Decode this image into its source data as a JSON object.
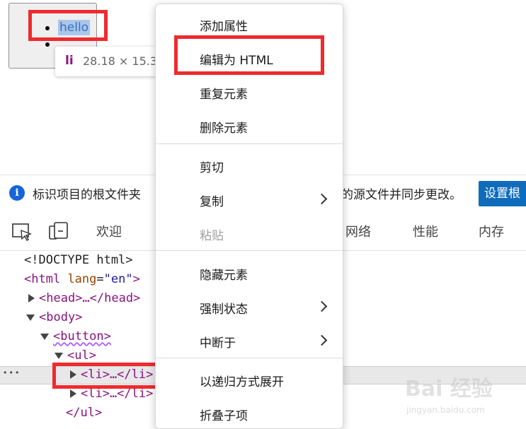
{
  "preview": {
    "list_item_text": "hello",
    "tooltip_tag": "li",
    "tooltip_size": "28.18 × 15.3"
  },
  "infobar": {
    "text_left": "标识项目的根文件夹",
    "text_right": "的源文件并同步更改。",
    "button_label": "设置根"
  },
  "tabs": {
    "welcome": "欢迎",
    "network": "网络",
    "performance": "性能",
    "memory": "内存"
  },
  "dom": {
    "doctype": "<!DOCTYPE html>",
    "html_tag_open": "<html",
    "html_attr": "lang",
    "html_eq": "=",
    "html_attr_value": "\"en\"",
    "html_tag_close": ">",
    "head": "<head>…</head>",
    "body": "<body>",
    "button": "<button>",
    "ul": "<ul>",
    "li_selected": "<li>…</li>",
    "li_second": "<li>…</li>",
    "ul_close": "</ul>",
    "row_dots": "•••"
  },
  "context_menu": {
    "items": [
      {
        "label": "添加属性"
      },
      {
        "label": "编辑为 HTML"
      },
      {
        "label": "重复元素"
      },
      {
        "label": "删除元素"
      },
      {
        "label": "剪切"
      },
      {
        "label": "复制"
      },
      {
        "label": "粘贴"
      },
      {
        "label": "隐藏元素"
      },
      {
        "label": "强制状态"
      },
      {
        "label": "中断于"
      },
      {
        "label": "以递归方式展开"
      },
      {
        "label": "折叠子项"
      }
    ]
  },
  "watermark": {
    "brand": "Bai 经验",
    "url": "jingyan.baidu.com"
  },
  "colors": {
    "highlight_red": "#ee2b2f",
    "accent_blue": "#0f6cbd",
    "tag_purple": "#881280"
  }
}
